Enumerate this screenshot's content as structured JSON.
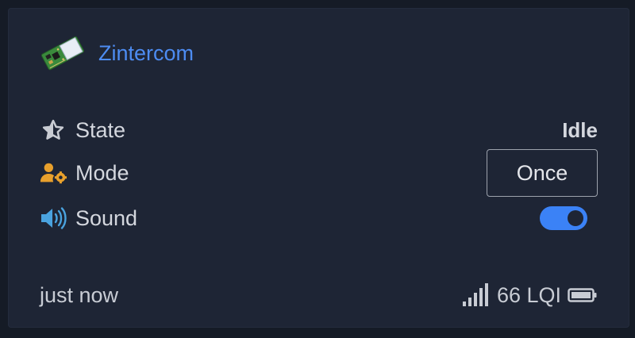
{
  "device": {
    "name": "Zintercom",
    "image_icon": "zigbee-module-icon"
  },
  "rows": {
    "state": {
      "label": "State",
      "icon": "star-icon",
      "value": "Idle"
    },
    "mode": {
      "label": "Mode",
      "icon": "user-gear-icon",
      "value": "Once"
    },
    "sound": {
      "label": "Sound",
      "icon": "speaker-icon",
      "enabled": true
    }
  },
  "footer": {
    "last_seen": "just now",
    "lqi": "66 LQI",
    "signal_icon": "signal-bars-icon",
    "battery_icon": "battery-icon"
  },
  "colors": {
    "accent": "#4d8cf2",
    "toggle_on": "#3b82f6",
    "mode_icon": "#e8a02c",
    "sound_icon": "#4aa3df"
  }
}
